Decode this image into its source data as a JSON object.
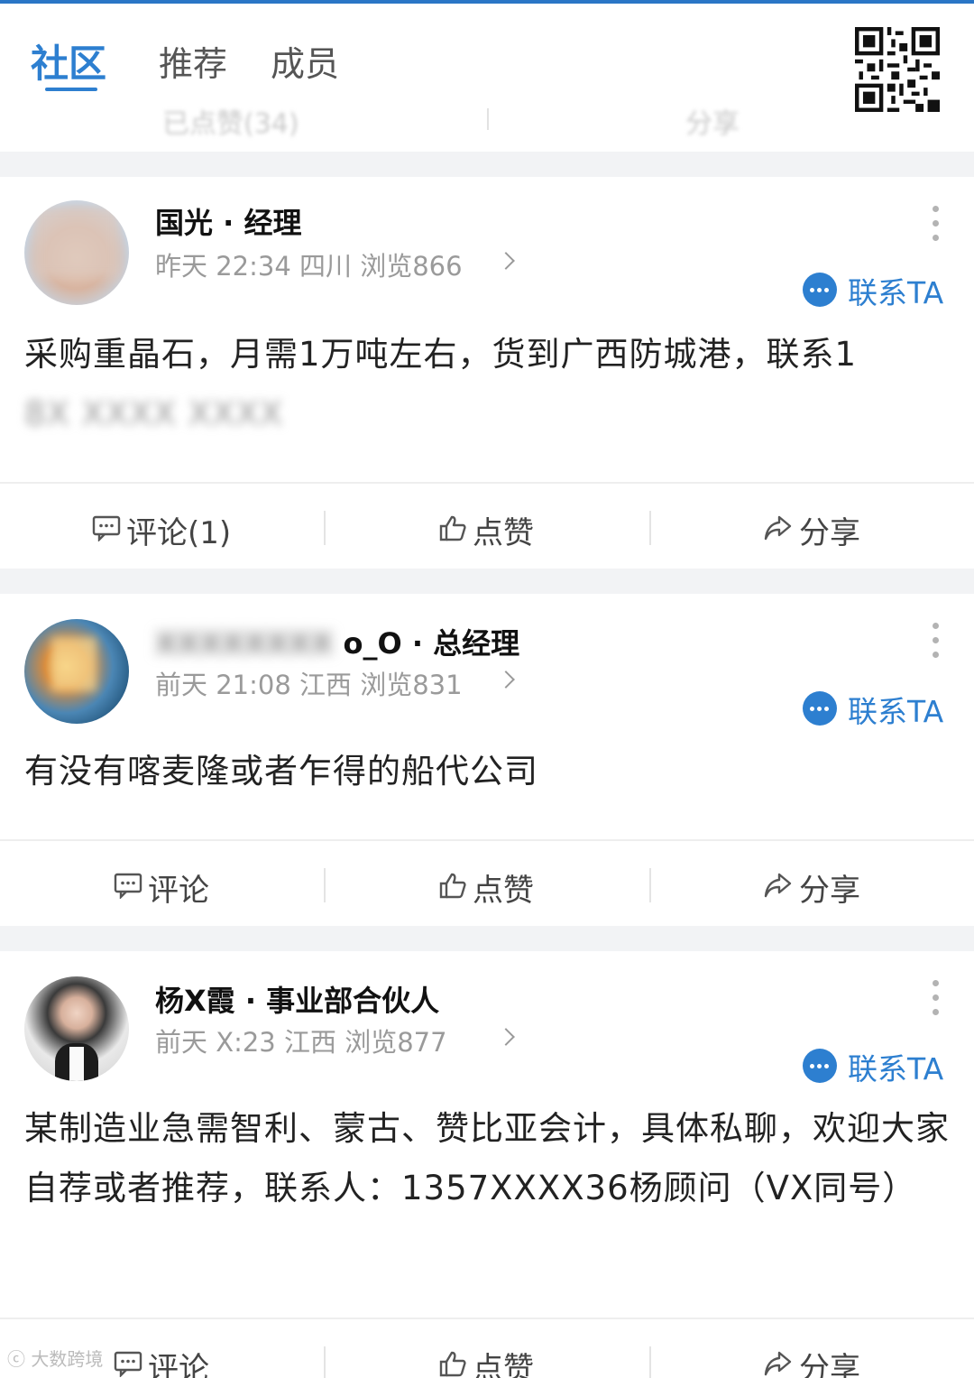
{
  "tabs": [
    "社区",
    "推荐",
    "成员"
  ],
  "header_ghost": {
    "left": "已点赞(34)",
    "right": "分享"
  },
  "contact_label": "联系TA",
  "posts": [
    {
      "name": "国光 · 经理",
      "meta": "昨天 22:34 四川 浏览866",
      "content": "采购重晶石，月需1万吨左右，货到广西防城港，联系1",
      "content_blur": "8X XXXX XXXX",
      "actions": {
        "comment": "评论(1)",
        "like": "点赞",
        "share": "分享"
      }
    },
    {
      "name_blur": "XXXXXXXX",
      "name": "o_O · 总经理",
      "meta": "前天 21:08 江西 浏览831",
      "content": "有没有喀麦隆或者乍得的船代公司",
      "actions": {
        "comment": "评论",
        "like": "点赞",
        "share": "分享"
      }
    },
    {
      "name": "杨X霞 · 事业部合伙人",
      "meta": "前天 X:23 江西 浏览877",
      "content": "某制造业急需智利、蒙古、赞比亚会计，具体私聊，欢迎大家自荐或者推荐，联系人：1357XXXX36杨顾问（VX同号）",
      "actions": {
        "comment": "评论",
        "like": "点赞",
        "share": "分享"
      }
    }
  ],
  "watermark": "大数跨境"
}
